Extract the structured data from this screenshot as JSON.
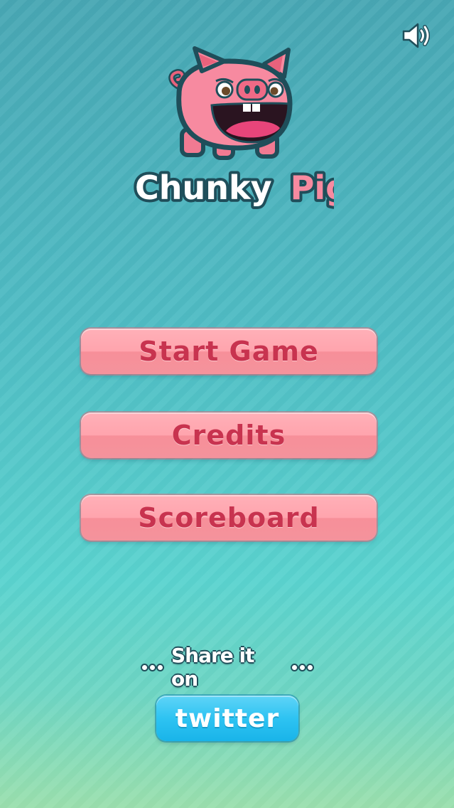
{
  "app": {
    "title_part1": "Chunky",
    "title_part2": "Pig"
  },
  "controls": {
    "sound_icon": "speaker-volume-icon"
  },
  "menu": {
    "start_label": "Start Game",
    "credits_label": "Credits",
    "scoreboard_label": "Scoreboard"
  },
  "share": {
    "label": "Share it on",
    "twitter_label": "twitter"
  },
  "colors": {
    "button_pink": "#ffa4ad",
    "button_text": "#c8334f",
    "twitter_blue": "#2ec3f2",
    "background_teal": "#4fbcc4"
  }
}
